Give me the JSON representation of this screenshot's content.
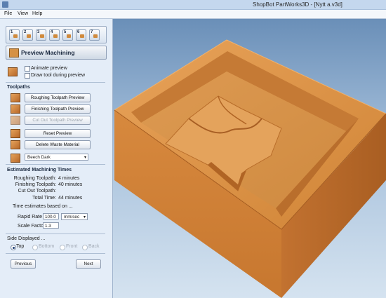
{
  "window": {
    "title": "ShopBot PartWorks3D - [Nytt a.v3d]"
  },
  "menu": [
    {
      "label": "File"
    },
    {
      "label": "View"
    },
    {
      "label": "Help"
    }
  ],
  "steps": [
    "1",
    "2",
    "3",
    "4",
    "5",
    "6",
    "7"
  ],
  "panel": {
    "header": "Preview Machining",
    "animate_preview": "Animate preview",
    "draw_tool": "Draw tool during preview",
    "toolpaths_title": "Toolpaths",
    "roughing_btn": "Roughing Toolpath Preview",
    "finishing_btn": "Finishing Toolpath Preview",
    "cutout_btn": "Cut Out Toolpath Preview",
    "reset_btn": "Reset Preview",
    "delete_btn": "Delete Waste Material",
    "material": "Beech Dark",
    "times_title": "Estimated Machining Times",
    "times": [
      {
        "label": "Roughing Toolpath:",
        "value": "4 minutes"
      },
      {
        "label": "Finishing Toolpath:",
        "value": "40 minutes"
      },
      {
        "label": "Cut Out Toolpath:",
        "value": ""
      },
      {
        "label": "Total Time:",
        "value": "44 minutes"
      }
    ],
    "estimates_based": "Time estimates based on ...",
    "rapid_rate_label": "Rapid Rate",
    "rapid_rate_value": "100.0",
    "rapid_rate_unit": "mm/sec",
    "scale_factor_label": "Scale Factor",
    "scale_factor_value": "1.3",
    "side_title": "Side Displayed ...",
    "sides": [
      {
        "label": "Top",
        "selected": true,
        "enabled": true
      },
      {
        "label": "Bottom",
        "selected": false,
        "enabled": false
      },
      {
        "label": "Front",
        "selected": false,
        "enabled": false
      },
      {
        "label": "Back",
        "selected": false,
        "enabled": false
      }
    ],
    "previous_btn": "Previous",
    "next_btn": "Next"
  },
  "colors": {
    "wood_light": "#e0944a",
    "wood_dark": "#b8692a",
    "background_top": "#6a8fb8",
    "background_bottom": "#d5e3f0"
  }
}
